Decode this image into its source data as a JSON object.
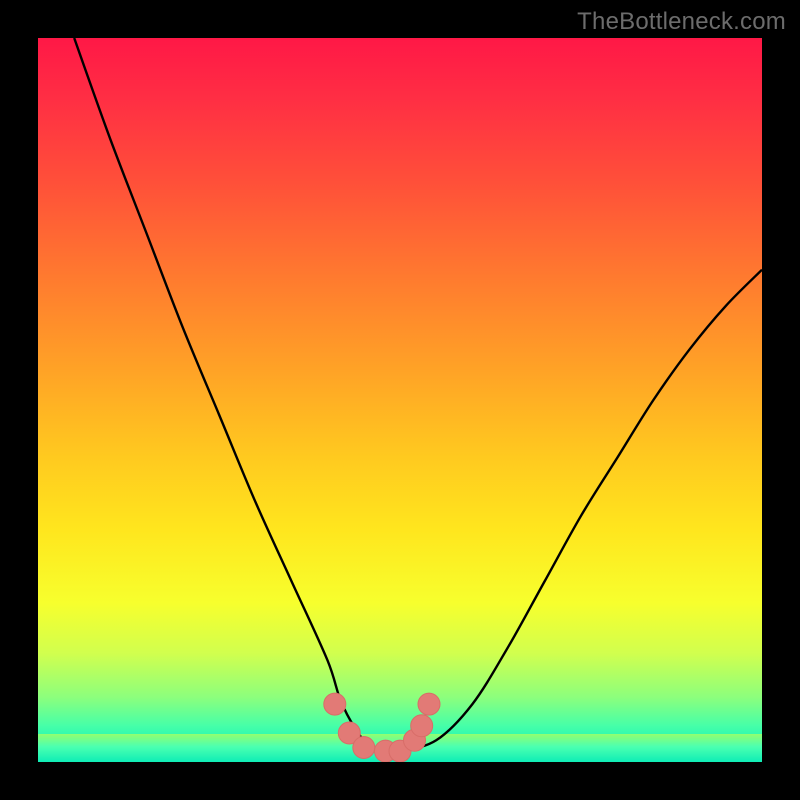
{
  "watermark": {
    "text": "TheBottleneck.com"
  },
  "colors": {
    "curve_stroke": "#000000",
    "marker_fill": "#e27a76",
    "marker_stroke": "#d86d68"
  },
  "chart_data": {
    "type": "line",
    "title": "",
    "xlabel": "",
    "ylabel": "",
    "xlim": [
      0,
      100
    ],
    "ylim": [
      0,
      100
    ],
    "grid": false,
    "legend": false,
    "series": [
      {
        "name": "bottleneck-curve",
        "x": [
          5,
          10,
          15,
          20,
          25,
          30,
          35,
          40,
          42,
          45,
          48,
          50,
          55,
          60,
          65,
          70,
          75,
          80,
          85,
          90,
          95,
          100
        ],
        "y": [
          100,
          86,
          73,
          60,
          48,
          36,
          25,
          14,
          8,
          3,
          1.5,
          1.5,
          3,
          8,
          16,
          25,
          34,
          42,
          50,
          57,
          63,
          68
        ]
      }
    ],
    "markers": {
      "name": "optimal-range",
      "points": [
        {
          "x": 41,
          "y": 8
        },
        {
          "x": 43,
          "y": 4
        },
        {
          "x": 45,
          "y": 2
        },
        {
          "x": 48,
          "y": 1.5
        },
        {
          "x": 50,
          "y": 1.5
        },
        {
          "x": 52,
          "y": 3
        },
        {
          "x": 53,
          "y": 5
        },
        {
          "x": 54,
          "y": 8
        }
      ],
      "radius": 11
    }
  }
}
